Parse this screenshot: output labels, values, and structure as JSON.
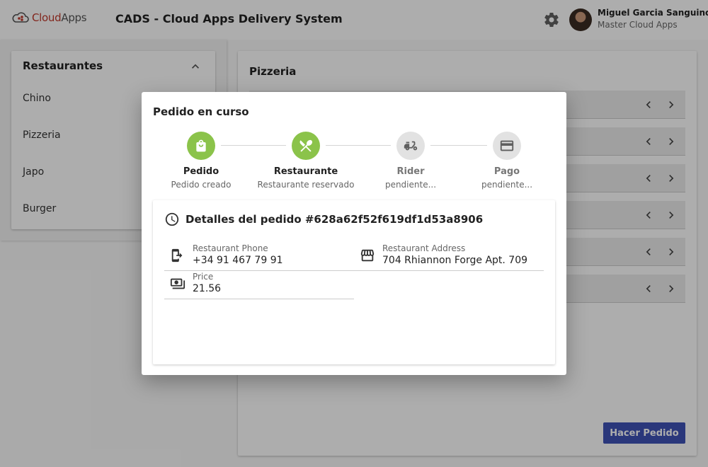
{
  "header": {
    "logo_text_primary": "Cloud",
    "logo_text_secondary": "Apps",
    "app_title": "CADS - Cloud Apps Delivery System",
    "user_name": "Miguel Garcia Sanguino",
    "user_org": "Master Cloud Apps"
  },
  "sidebar": {
    "title": "Restaurantes",
    "items": [
      {
        "label": "Chino"
      },
      {
        "label": "Pizzeria"
      },
      {
        "label": "Japo"
      },
      {
        "label": "Burger"
      }
    ]
  },
  "main": {
    "title": "Pizzeria",
    "rows": [
      {},
      {},
      {},
      {},
      {},
      {}
    ],
    "order_button": "Hacer Pedido"
  },
  "dialog": {
    "title": "Pedido en curso",
    "steps": [
      {
        "label": "Pedido",
        "sub": "Pedido creado",
        "state": "done",
        "icon": "shopping-bag-icon"
      },
      {
        "label": "Restaurante",
        "sub": "Restaurante reservado",
        "state": "done",
        "icon": "restaurant-icon"
      },
      {
        "label": "Rider",
        "sub": "pendiente...",
        "state": "pending",
        "icon": "scooter-icon"
      },
      {
        "label": "Pago",
        "sub": "pendiente...",
        "state": "pending",
        "icon": "credit-card-icon"
      }
    ],
    "details": {
      "title": "Detalles del pedido #628a62f52f619df1d53a8906",
      "fields": {
        "phone": {
          "label": "Restaurant Phone",
          "value": "+34 91 467 79 91"
        },
        "address": {
          "label": "Restaurant Address",
          "value": "704 Rhiannon Forge Apt. 709"
        },
        "price": {
          "label": "Price",
          "value": "21.56"
        }
      }
    }
  },
  "colors": {
    "accent": "#3f51b5",
    "step_done": "#8bc34a",
    "step_pending": "#e2e2e2",
    "logo_red": "#c0392b"
  }
}
